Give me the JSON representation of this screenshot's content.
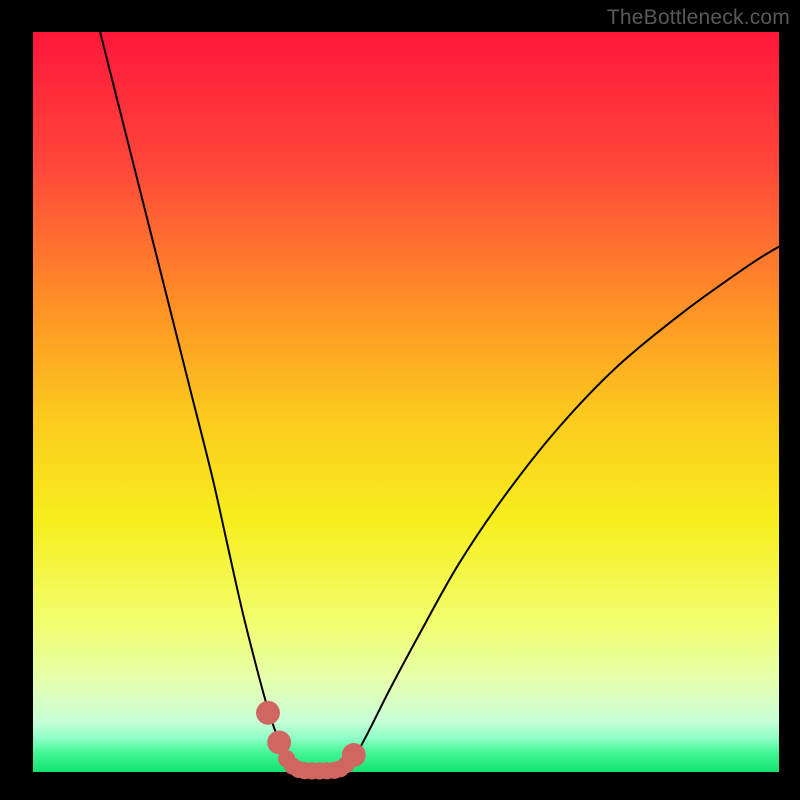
{
  "watermark": "TheBottleneck.com",
  "colors": {
    "black": "#000000",
    "curve": "#000000",
    "dots": "#cf6661",
    "gradient_stops": [
      {
        "offset": 0.0,
        "color": "#ff173b"
      },
      {
        "offset": 0.18,
        "color": "#ff463a"
      },
      {
        "offset": 0.38,
        "color": "#ff9525"
      },
      {
        "offset": 0.52,
        "color": "#fcca1e"
      },
      {
        "offset": 0.66,
        "color": "#f7ee1e"
      },
      {
        "offset": 0.8,
        "color": "#f2ff70"
      },
      {
        "offset": 0.88,
        "color": "#e4ffb0"
      },
      {
        "offset": 0.932,
        "color": "#c7ffd8"
      },
      {
        "offset": 0.955,
        "color": "#8cffc6"
      },
      {
        "offset": 0.975,
        "color": "#40f693"
      },
      {
        "offset": 1.0,
        "color": "#13e26e"
      }
    ]
  },
  "chart_data": {
    "type": "line",
    "title": "",
    "xlabel": "",
    "ylabel": "",
    "xlim": [
      0,
      100
    ],
    "ylim": [
      0,
      100
    ],
    "series": [
      {
        "name": "bottleneck-curve",
        "x": [
          9,
          12,
          15,
          18,
          21,
          24,
          26,
          28,
          30,
          31.5,
          33,
          34.5,
          35.5,
          36.5,
          41,
          42,
          43,
          45,
          48,
          52,
          57,
          63,
          70,
          78,
          87,
          96,
          100
        ],
        "y": [
          100,
          88,
          76,
          64,
          52,
          40,
          31,
          22,
          14,
          8.5,
          4.2,
          1.6,
          0.6,
          0.2,
          0.2,
          0.7,
          1.8,
          5.5,
          11.5,
          19,
          28,
          37,
          46,
          54.5,
          62,
          68.5,
          71
        ]
      }
    ],
    "highlight_dots": {
      "name": "sweet-spot-dots",
      "x": [
        31.5,
        33.0,
        34.0,
        34.8,
        35.6,
        36.4,
        37.4,
        38.4,
        39.4,
        40.4,
        41.2,
        42.0,
        43.0
      ],
      "y": [
        8.0,
        4.0,
        1.8,
        0.8,
        0.35,
        0.18,
        0.14,
        0.14,
        0.16,
        0.22,
        0.45,
        1.0,
        2.3
      ],
      "r_large_idx": [
        0,
        1,
        12
      ],
      "r_large": 1.6,
      "r_small": 1.15
    }
  }
}
